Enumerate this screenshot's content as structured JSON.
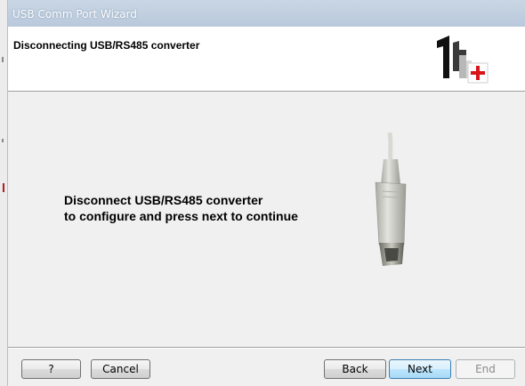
{
  "window": {
    "title": "USB Comm Port Wizard"
  },
  "header": {
    "heading": "Disconnecting USB/RS485 converter",
    "logo_icon": "1t-plus-logo"
  },
  "content": {
    "message_line1": "Disconnect USB/RS485 converter",
    "message_line2": "to configure and press next to continue",
    "image_icon": "usb-b-cable-plug"
  },
  "buttons": {
    "help": "?",
    "cancel": "Cancel",
    "back": "Back",
    "next": "Next",
    "end": "End"
  },
  "colors": {
    "title_bar": "#bfcfe1",
    "logo_red": "#d8151b",
    "default_button_border": "#3c7fb1"
  }
}
